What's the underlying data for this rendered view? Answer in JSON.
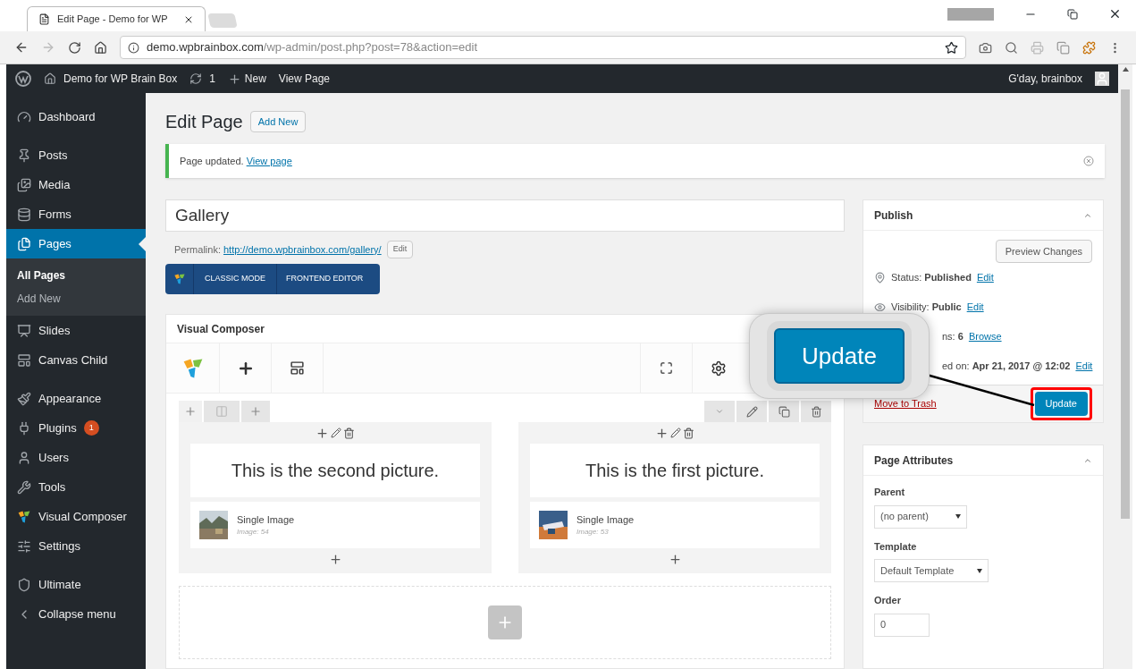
{
  "browser": {
    "tab_title": "Edit Page - Demo for WP",
    "url_host": "demo.wpbrainbox.com",
    "url_path": "/wp-admin/post.php?post=78&action=edit"
  },
  "admin_bar": {
    "site": "Demo for WP Brain Box",
    "updates": "1",
    "new": "New",
    "view": "View Page",
    "greeting": "G'day, brainbox"
  },
  "sidebar": {
    "items": [
      {
        "label": "Dashboard",
        "selected": false
      },
      {
        "label": "Posts",
        "selected": false
      },
      {
        "label": "Media",
        "selected": false
      },
      {
        "label": "Forms",
        "selected": false
      },
      {
        "label": "Pages",
        "selected": true,
        "children": [
          {
            "label": "All Pages",
            "selected": true
          },
          {
            "label": "Add New",
            "selected": false
          }
        ]
      },
      {
        "label": "Slides",
        "selected": false
      },
      {
        "label": "Canvas Child",
        "selected": false
      },
      {
        "label": "Appearance",
        "selected": false
      },
      {
        "label": "Plugins",
        "selected": false,
        "badge": "1"
      },
      {
        "label": "Users",
        "selected": false
      },
      {
        "label": "Tools",
        "selected": false
      },
      {
        "label": "Visual Composer",
        "selected": false
      },
      {
        "label": "Settings",
        "selected": false
      },
      {
        "label": "Ultimate",
        "selected": false
      },
      {
        "label": "Collapse menu",
        "selected": false
      }
    ]
  },
  "header": {
    "title": "Edit Page",
    "add_new": "Add New"
  },
  "notice": {
    "text": "Page updated.",
    "link": "View page"
  },
  "post_title": "Gallery",
  "permalink": {
    "label": "Permalink:",
    "url": "http://demo.wpbrainbox.com/gallery/",
    "edit": "Edit"
  },
  "composer_modes": [
    "CLASSIC MODE",
    "FRONTEND EDITOR"
  ],
  "composer": {
    "title": "Visual Composer",
    "columns": [
      {
        "text": "This is the second picture.",
        "element": "Single Image",
        "caption": "Image: 54"
      },
      {
        "text": "This is the first picture.",
        "element": "Single Image",
        "caption": "Image: 53"
      }
    ]
  },
  "publish": {
    "title": "Publish",
    "preview": "Preview Changes",
    "rows": [
      {
        "label": "Status:",
        "value": "Published",
        "link": "Edit"
      },
      {
        "label": "Visibility:",
        "value": "Public",
        "link": "Edit"
      },
      {
        "label": "ns:",
        "value": "6",
        "link": "Browse"
      },
      {
        "label": "ed on:",
        "value": "Apr 21, 2017 @ 12:02",
        "link": "Edit"
      }
    ],
    "trash": "Move to Trash",
    "update": "Update"
  },
  "attributes": {
    "title": "Page Attributes",
    "parent_label": "Parent",
    "parent": "(no parent)",
    "template_label": "Template",
    "template": "Default Template",
    "order_label": "Order",
    "order": "0"
  },
  "callout": {
    "label": "Update"
  }
}
